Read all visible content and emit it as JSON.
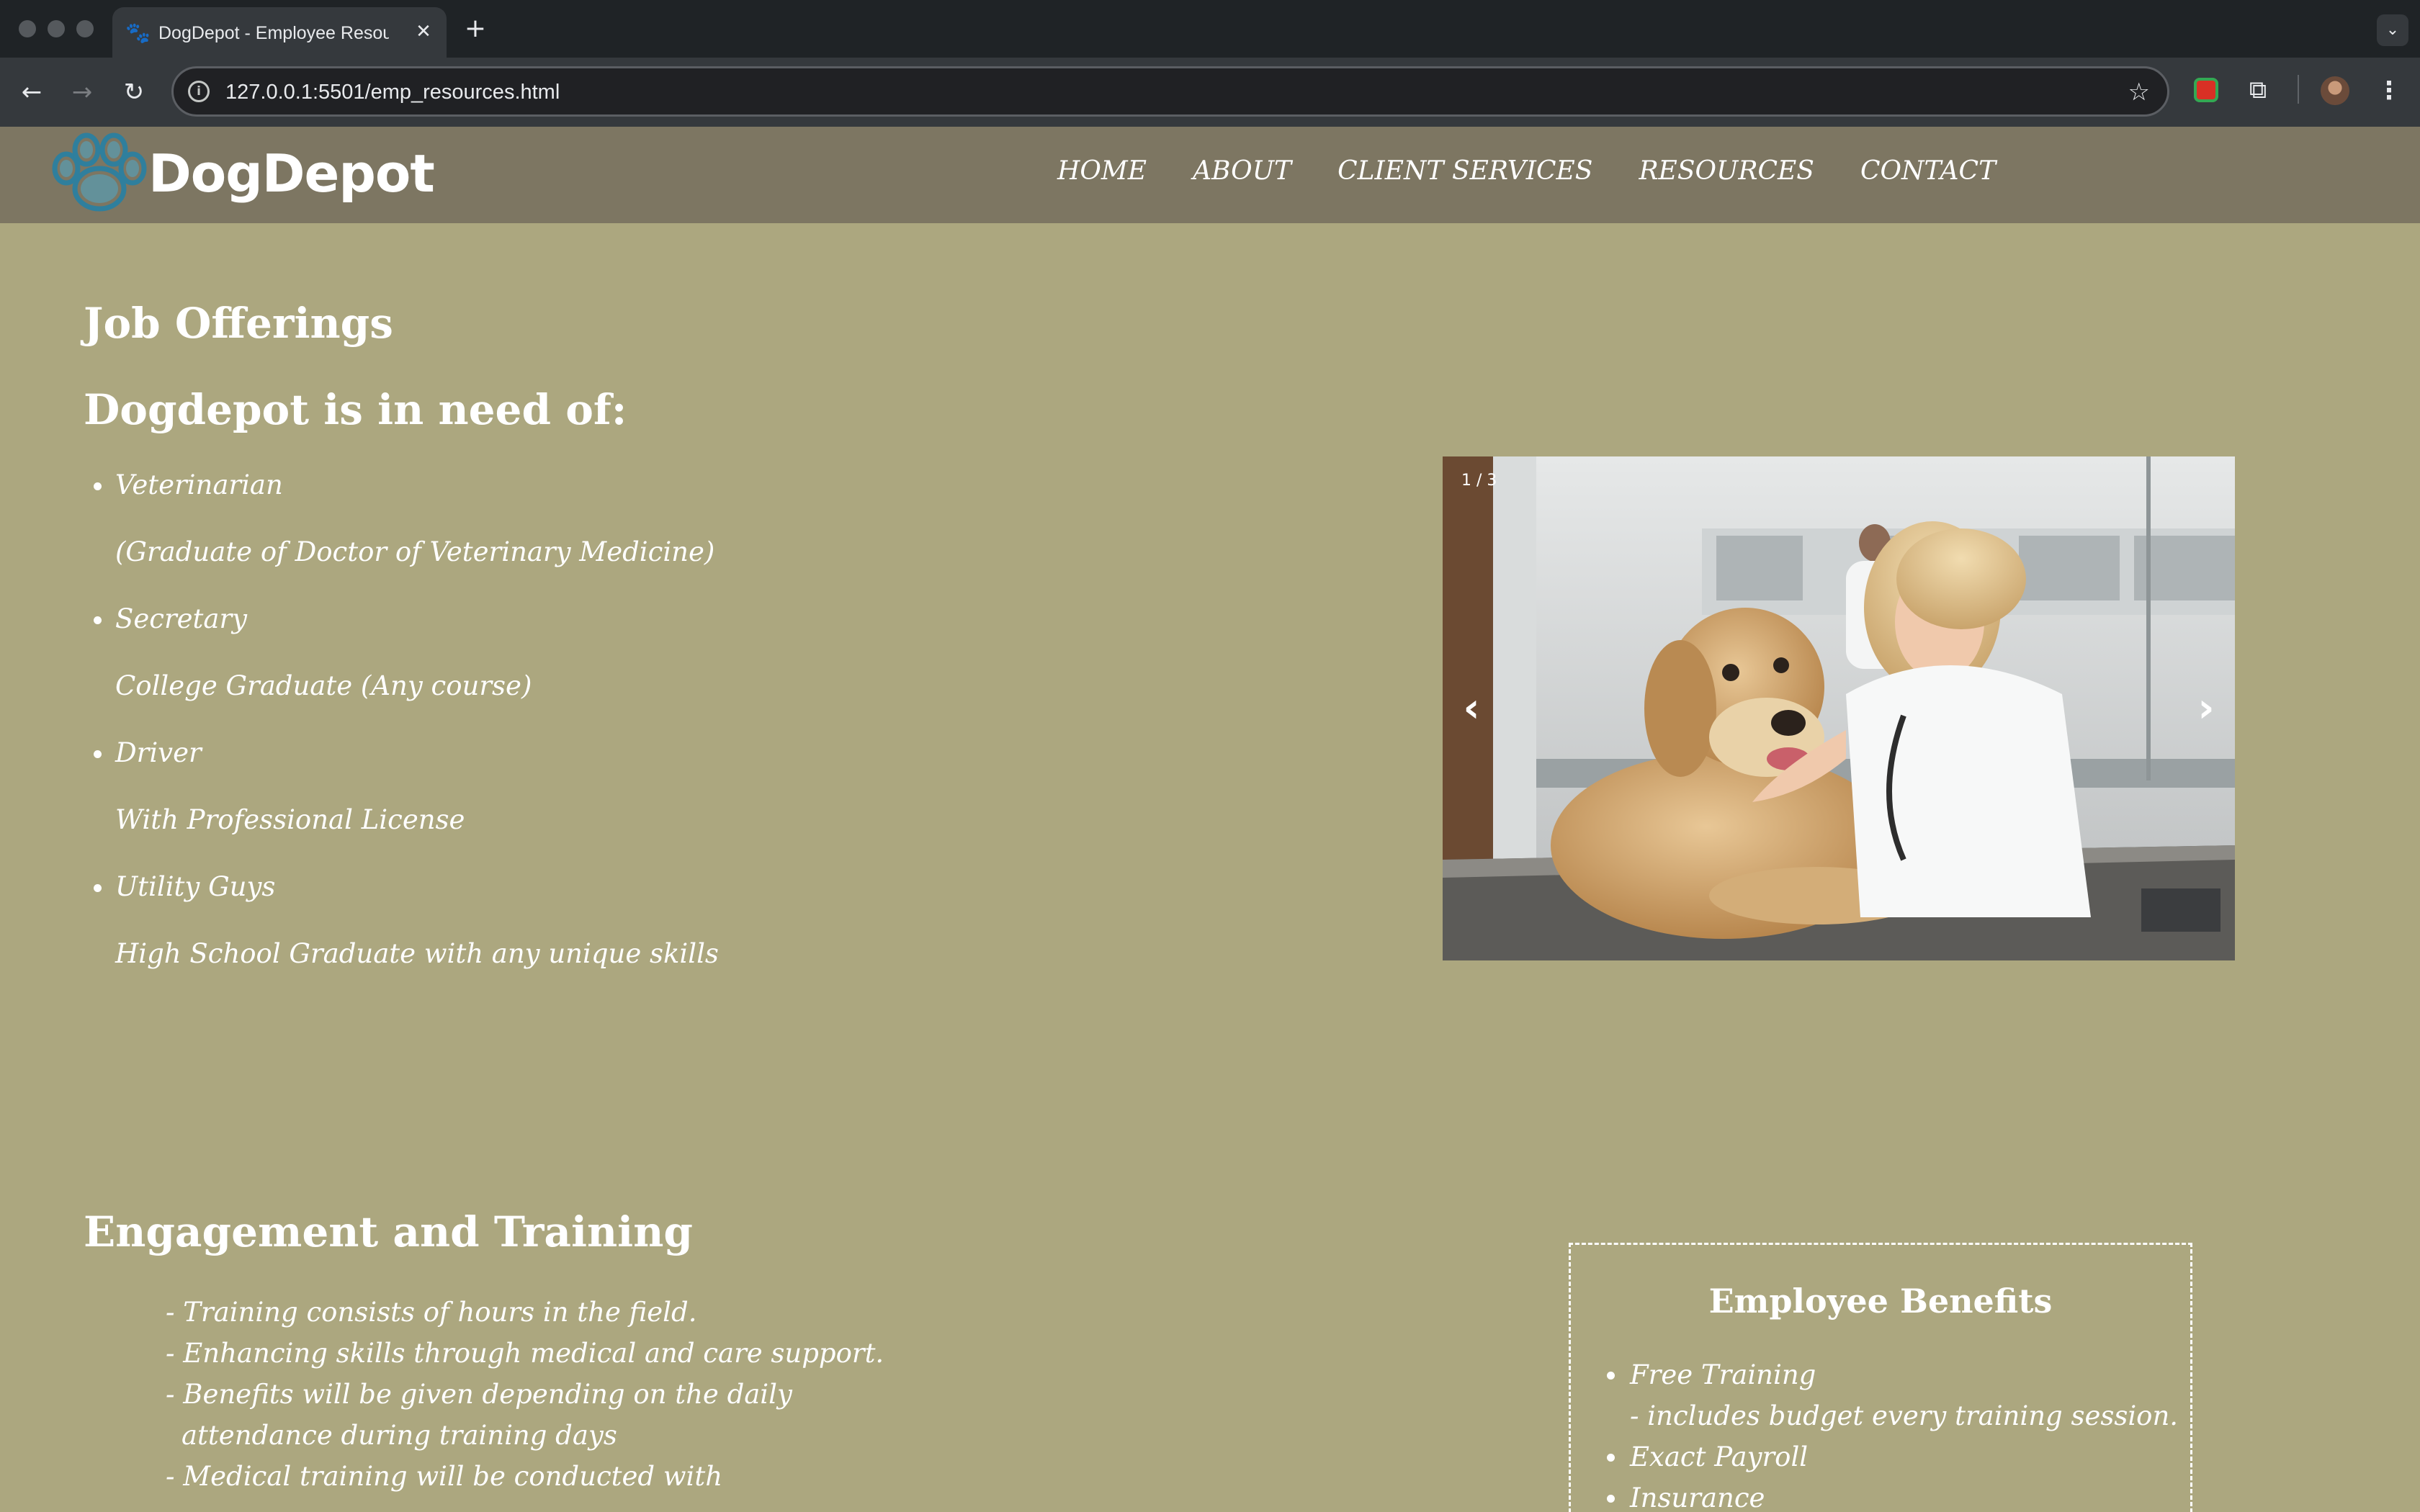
{
  "browser": {
    "tab_title": "DogDepot - Employee Resources",
    "url": "127.0.0.1:5501/emp_resources.html"
  },
  "site": {
    "logo_text": "DogDepot",
    "nav": [
      "HOME",
      "ABOUT",
      "CLIENT SERVICES",
      "RESOURCES",
      "CONTACT"
    ]
  },
  "jobs": {
    "heading": "Job Offerings",
    "subheading": "Dogdepot is in need of:",
    "items": [
      {
        "title": "Veterinarian",
        "requirement": "(Graduate of Doctor of Veterinary Medicine)"
      },
      {
        "title": "Secretary",
        "requirement": "College Graduate (Any course)"
      },
      {
        "title": "Driver",
        "requirement": "With Professional License"
      },
      {
        "title": "Utility Guys",
        "requirement": "High School Graduate with any unique skills"
      }
    ]
  },
  "carousel": {
    "counter": "1 / 3",
    "prev": "‹",
    "next": "›"
  },
  "training": {
    "heading": "Engagement and Training",
    "lines": [
      {
        "text": "- Training consists of hours in the field."
      },
      {
        "text": "- Enhancing skills through medical and care support."
      },
      {
        "text": "- Benefits will be given depending on the daily"
      },
      {
        "text": "attendance during training days"
      },
      {
        "text": "- Medical training will be conducted with"
      }
    ]
  },
  "benefits": {
    "title": "Employee Benefits",
    "items": [
      "Free Training",
      "Exact Payroll",
      "Insurance"
    ],
    "free_training_note": "- includes budget every training session."
  },
  "colors": {
    "page_bg": "#aca77f",
    "header_bg": "#7d7662",
    "logo_paw": "#3a8fb0"
  }
}
